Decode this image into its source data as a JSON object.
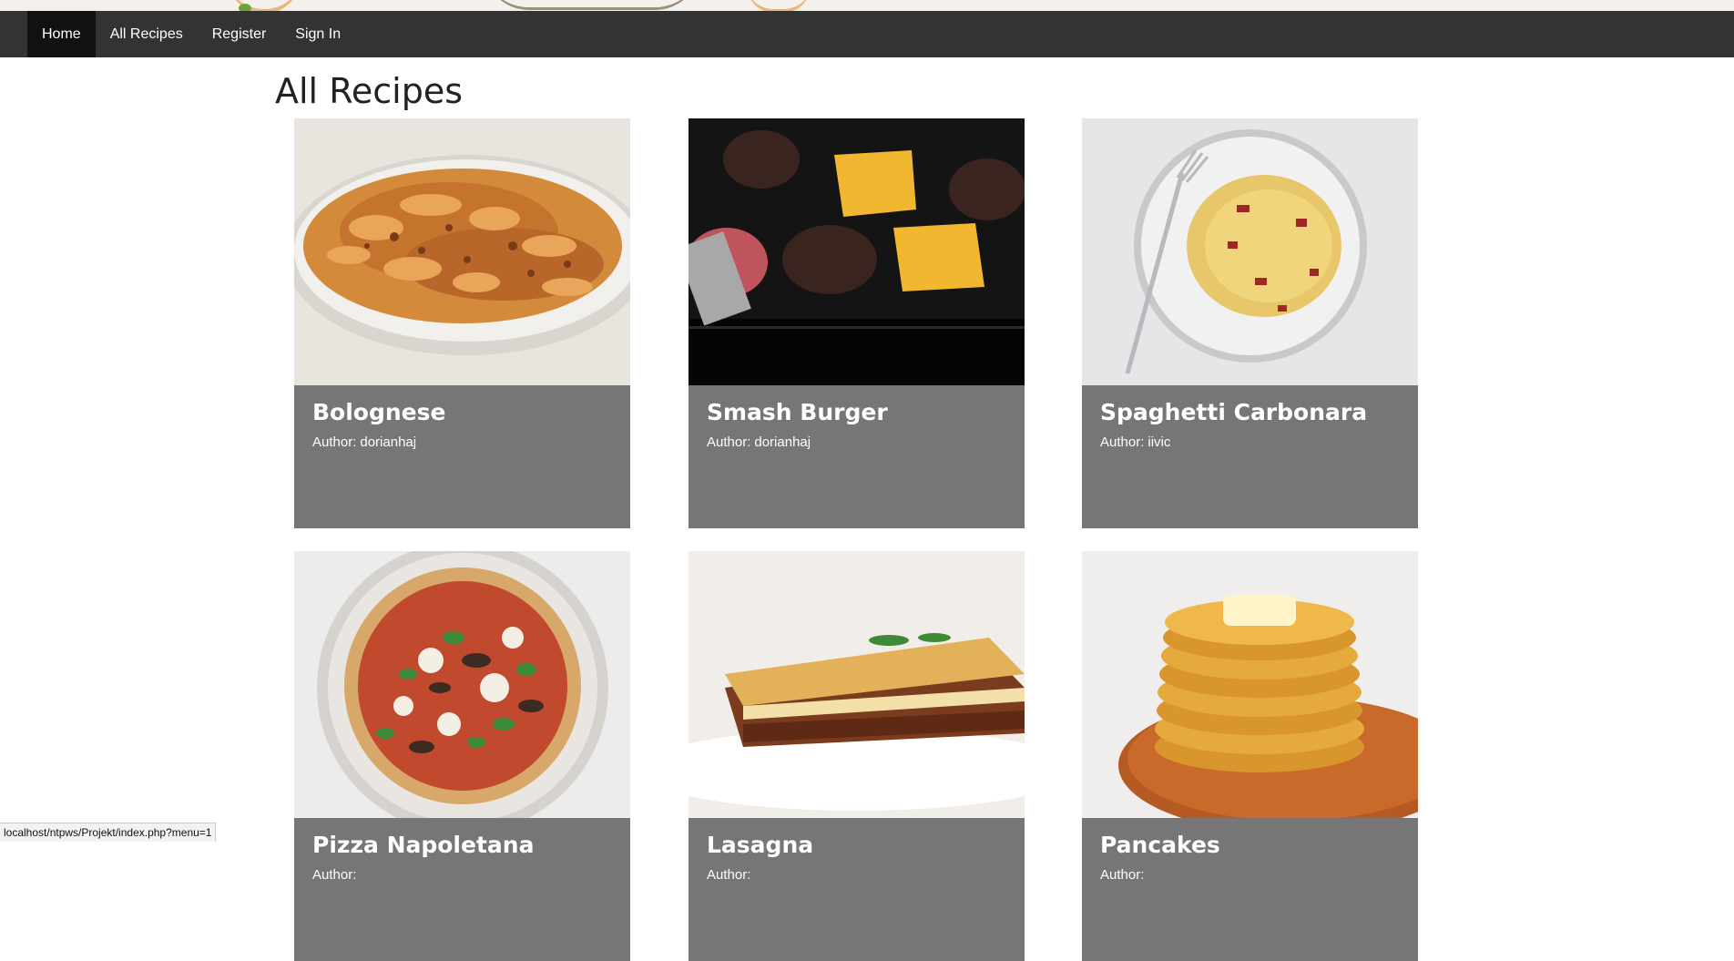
{
  "nav": {
    "items": [
      {
        "label": "Home",
        "active": true
      },
      {
        "label": "All Recipes",
        "active": false
      },
      {
        "label": "Register",
        "active": false
      },
      {
        "label": "Sign In",
        "active": false
      }
    ]
  },
  "page": {
    "title": "All Recipes"
  },
  "recipes": [
    {
      "title": "Bolognese",
      "author_label": "Author:",
      "author": "dorianhaj",
      "image": "pappardelle-bolognese-photo"
    },
    {
      "title": "Smash Burger",
      "author_label": "Author:",
      "author": "dorianhaj",
      "image": "smash-burger-griddle-photo"
    },
    {
      "title": "Spaghetti Carbonara",
      "author_label": "Author:",
      "author": "iivic",
      "image": "spaghetti-carbonara-photo"
    },
    {
      "title": "Pizza Napoletana",
      "author_label": "Author:",
      "author": "",
      "image": "pizza-photo"
    },
    {
      "title": "Lasagna",
      "author_label": "Author:",
      "author": "",
      "image": "lasagna-photo"
    },
    {
      "title": "Pancakes",
      "author_label": "Author:",
      "author": "",
      "image": "pancake-stack-photo"
    }
  ],
  "status": {
    "url": "localhost/ntpws/Projekt/index.php?menu=1"
  },
  "colors": {
    "nav_bg": "#333333",
    "nav_active": "#111111",
    "card_bg": "#767676",
    "text_light": "#ffffff"
  }
}
